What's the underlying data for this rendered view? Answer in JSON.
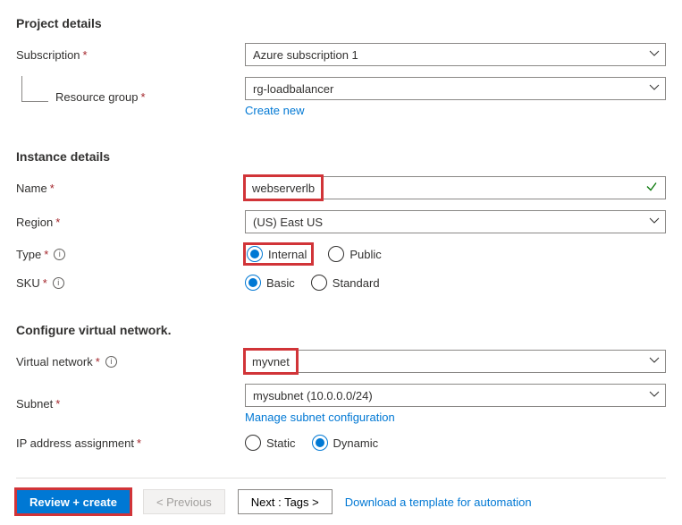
{
  "sections": {
    "project": "Project details",
    "instance": "Instance details",
    "network": "Configure virtual network."
  },
  "labels": {
    "subscription": "Subscription",
    "resource_group": "Resource group",
    "name": "Name",
    "region": "Region",
    "type": "Type",
    "sku": "SKU",
    "vnet": "Virtual network",
    "subnet": "Subnet",
    "ip_assign": "IP address assignment"
  },
  "values": {
    "subscription": "Azure subscription 1",
    "resource_group": "rg-loadbalancer",
    "name": "webserverlb",
    "region": "(US) East US",
    "vnet": "myvnet",
    "subnet": "mysubnet (10.0.0.0/24)"
  },
  "links": {
    "create_new": "Create new",
    "manage_subnet": "Manage subnet configuration",
    "download_template": "Download a template for automation"
  },
  "radios": {
    "type": {
      "internal": "Internal",
      "public": "Public"
    },
    "sku": {
      "basic": "Basic",
      "standard": "Standard"
    },
    "ip": {
      "static": "Static",
      "dynamic": "Dynamic"
    }
  },
  "footer": {
    "review": "Review + create",
    "previous": "< Previous",
    "next": "Next : Tags >"
  }
}
